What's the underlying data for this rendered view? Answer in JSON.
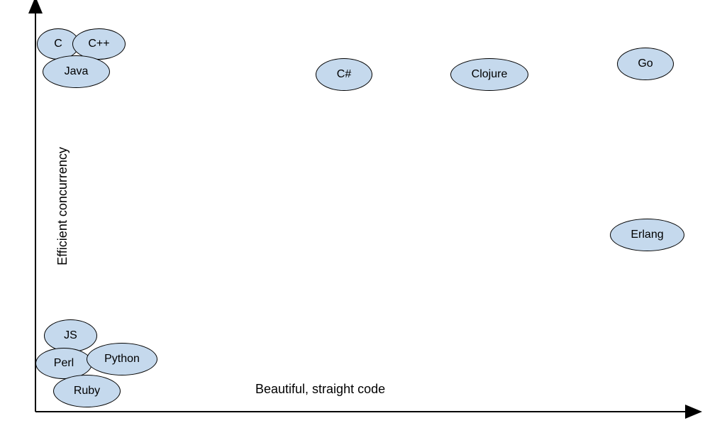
{
  "chart_data": {
    "type": "scatter",
    "xlabel": "Beautiful, straight code",
    "ylabel": "Efficient concurrency",
    "title": "",
    "xlim": [
      0,
      100
    ],
    "ylim": [
      0,
      100
    ],
    "points": [
      {
        "name": "C",
        "x": 5,
        "y": 93
      },
      {
        "name": "C++",
        "x": 11,
        "y": 93
      },
      {
        "name": "Java",
        "x": 8,
        "y": 85
      },
      {
        "name": "C#",
        "x": 46,
        "y": 84
      },
      {
        "name": "Clojure",
        "x": 67,
        "y": 84
      },
      {
        "name": "Go",
        "x": 91,
        "y": 87
      },
      {
        "name": "Erlang",
        "x": 91,
        "y": 44
      },
      {
        "name": "JS",
        "x": 7,
        "y": 17
      },
      {
        "name": "Perl",
        "x": 6,
        "y": 10
      },
      {
        "name": "Python",
        "x": 14,
        "y": 11
      },
      {
        "name": "Ruby",
        "x": 10,
        "y": 3
      }
    ]
  },
  "labels": {
    "c": "C",
    "cpp": "C++",
    "java": "Java",
    "csharp": "C#",
    "clojure": "Clojure",
    "go": "Go",
    "erlang": "Erlang",
    "js": "JS",
    "perl": "Perl",
    "python": "Python",
    "ruby": "Ruby"
  }
}
